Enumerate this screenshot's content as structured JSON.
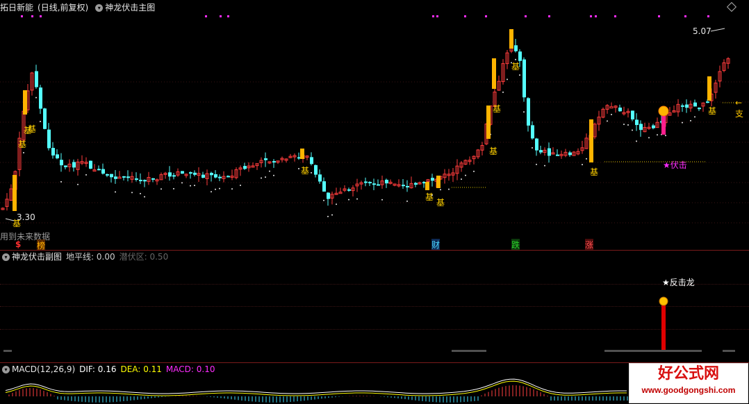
{
  "main_pane": {
    "stock_name": "拓日新能",
    "period_label": "(日线,前复权)",
    "indicator_name": "神龙伏击主图",
    "price_high_label": "5.07",
    "price_low_label": "3.30",
    "future_data_note": "用到未来数据",
    "right_arrow_label": "←支",
    "ji_label": "基",
    "fuji_label": "★伏击",
    "bottom_markers": [
      {
        "text": "$",
        "color": "#ff3030"
      },
      {
        "text": "榜",
        "color": "#ff9900"
      },
      {
        "text": "财",
        "color": "#4ad6ff"
      },
      {
        "text": "跌",
        "color": "#2bd12b"
      },
      {
        "text": "涨",
        "color": "#ff3030"
      }
    ]
  },
  "sub_pane": {
    "indicator_name": "神龙伏击副图",
    "horizon_label": "地平线:",
    "horizon_value": "0.00",
    "latent_label": "潜伏区:",
    "latent_value": "0.50",
    "signal_label": "★反击龙"
  },
  "macd_pane": {
    "title": "MACD(12,26,9)",
    "dif_label": "DIF:",
    "dif_value": "0.16",
    "dea_label": "DEA:",
    "dea_value": "0.11",
    "macd_label": "MACD:",
    "macd_value": "0.10"
  },
  "watermark": {
    "title": "好公式网",
    "url": "www.goodgongshi.com"
  },
  "colors": {
    "up": "#ff3c3c",
    "down": "#54ffff",
    "highlight": "#ffb400",
    "magenta": "#ff2cff",
    "axis": "#7a1b1b"
  }
}
